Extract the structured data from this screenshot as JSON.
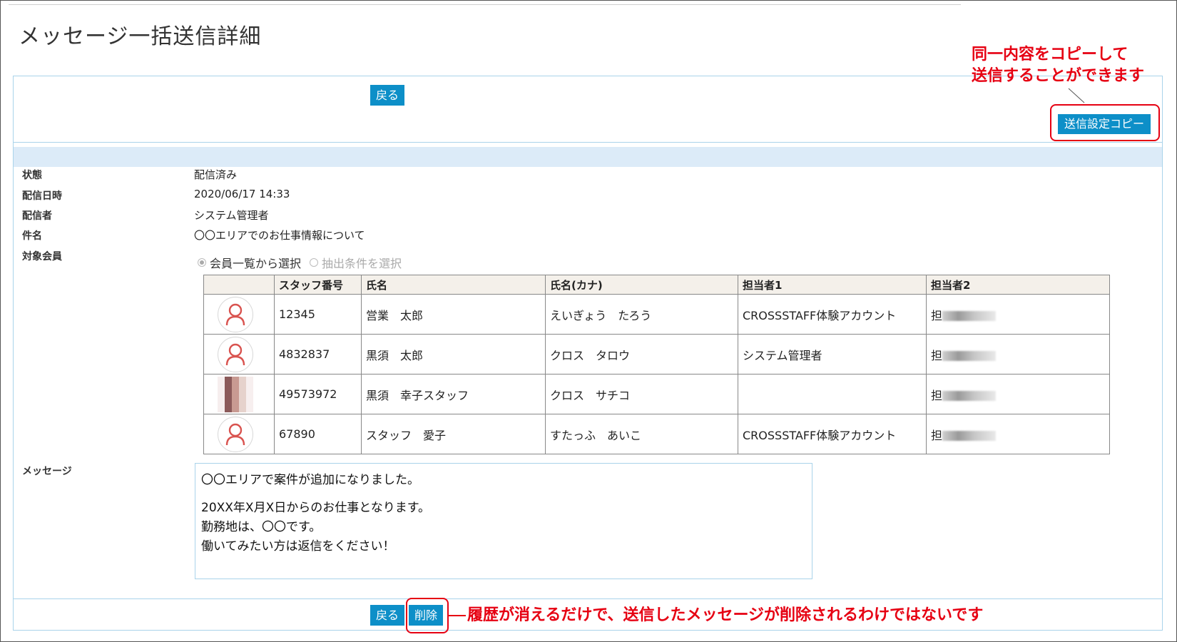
{
  "page": {
    "title": "メッセージ一括送信詳細"
  },
  "actions": {
    "back_label": "戻る",
    "copy_label": "送信設定コピー",
    "delete_label": "削除"
  },
  "annotations": {
    "copy_line1": "同一内容をコピーして",
    "copy_line2": "送信することができます",
    "delete_note": "履歴が消えるだけで、送信したメッセージが削除されるわけではないです",
    "color": "#e60012"
  },
  "details": {
    "status_label": "状態",
    "status_value": "配信済み",
    "date_label": "配信日時",
    "date_value": "2020/06/17 14:33",
    "sender_label": "配信者",
    "sender_value": "システム管理者",
    "subject_label": "件名",
    "subject_value": "〇〇エリアでのお仕事情報について",
    "target_label": "対象会員",
    "message_label": "メッセージ"
  },
  "target": {
    "option_list": "会員一覧から選択",
    "option_filter": "抽出条件を選択"
  },
  "members": {
    "headers": [
      "",
      "スタッフ番号",
      "氏名",
      "氏名(カナ)",
      "担当者1",
      "担当者2"
    ],
    "rows": [
      {
        "id": "12345",
        "name": "営業　太郎",
        "kana": "えいぎょう　たろう",
        "manager1": "CROSSSTAFF体験アカウント",
        "manager2": "担"
      },
      {
        "id": "4832837",
        "name": "黒須　太郎",
        "kana": "クロス　タロウ",
        "manager1": "システム管理者",
        "manager2": "担"
      },
      {
        "id": "49573972",
        "name": "黒須　幸子スタッフ",
        "kana": "クロス　サチコ",
        "manager1": "",
        "manager2": "担"
      },
      {
        "id": "67890",
        "name": "スタッフ　愛子",
        "kana": "すたっふ　あいこ",
        "manager1": "CROSSSTAFF体験アカウント",
        "manager2": "担"
      }
    ]
  },
  "message": {
    "line1": "〇〇エリアで案件が追加になりました。",
    "line2": "20XX年X月X日からのお仕事となります。",
    "line3": "勤務地は、〇〇です。",
    "line4": "働いてみたい方は返信をください！"
  },
  "colors": {
    "button": "#0d8fc8",
    "panel_border": "#a9d3ea",
    "band": "#dcebf8",
    "avatar_icon": "#d9534f"
  }
}
